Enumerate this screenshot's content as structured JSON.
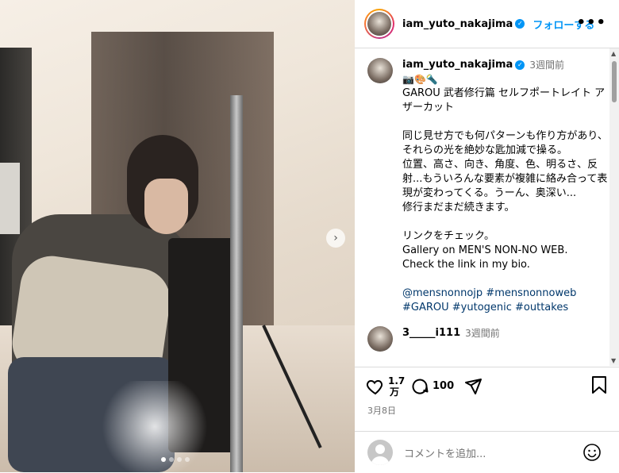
{
  "post": {
    "username": "iam_yuto_nakajima",
    "follow_label": "フォローする",
    "more_label": "•••"
  },
  "caption": {
    "username": "iam_yuto_nakajima",
    "time": "3週間前",
    "emoji": "📷🎨🔦",
    "text": "GAROU 武者修行篇 セルフポートレイト アザーカット\n\n同じ見せ方でも何パターンも作り方があり、それらの光を絶妙な匙加減で操る。\n位置、高さ、向き、角度、色、明るさ、反射...もういろんな要素が複雑に絡み合って表現が変わってくる。うーん、奥深い...\n修行まだまだ続きます。\n\nリンクをチェック。\nGallery on MEN'S NON-NO WEB.\nCheck the link in my bio.",
    "tags": "@mensnonnojp #mensnonnoweb #GAROU #yutogenic #outtakes"
  },
  "next_comment": {
    "username": "3_____i111",
    "time": "3週間前"
  },
  "actions": {
    "likes_top": "1.7",
    "likes_bottom": "万",
    "comments": "100"
  },
  "date": "3月8日",
  "add_comment": {
    "placeholder": "コメントを追加..."
  },
  "carousel": {
    "slide_count": 4,
    "active_index": 0
  }
}
